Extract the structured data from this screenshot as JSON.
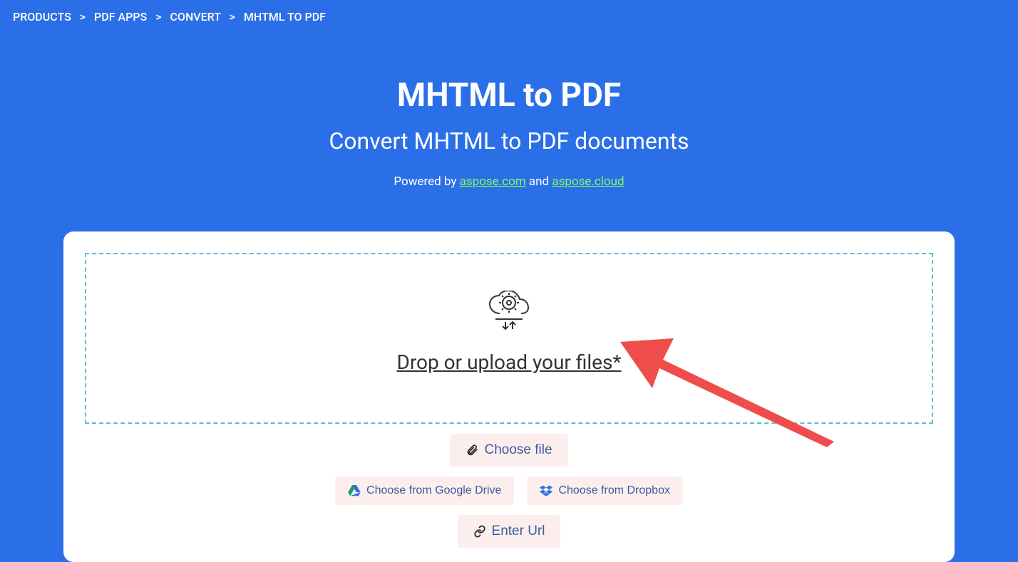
{
  "breadcrumb": {
    "items": [
      "PRODUCTS",
      "PDF APPS",
      "CONVERT",
      "MHTML TO PDF"
    ]
  },
  "hero": {
    "title": "MHTML to PDF",
    "subtitle": "Convert MHTML to PDF documents",
    "powered_prefix": "Powered by ",
    "powered_link1": "aspose.com",
    "powered_and": " and ",
    "powered_link2": "aspose.cloud"
  },
  "dropzone": {
    "label": "Drop or upload your files*"
  },
  "buttons": {
    "choose_file": "Choose file",
    "google_drive": "Choose from Google Drive",
    "dropbox": "Choose from Dropbox",
    "enter_url": "Enter Url"
  },
  "colors": {
    "bg": "#2b6fe8",
    "link_green": "#7fff5b",
    "btn_bg": "#fdeeee",
    "btn_text": "#3a5ba0",
    "dashed_border": "#5fbcd3",
    "arrow": "#ef4c4c"
  }
}
